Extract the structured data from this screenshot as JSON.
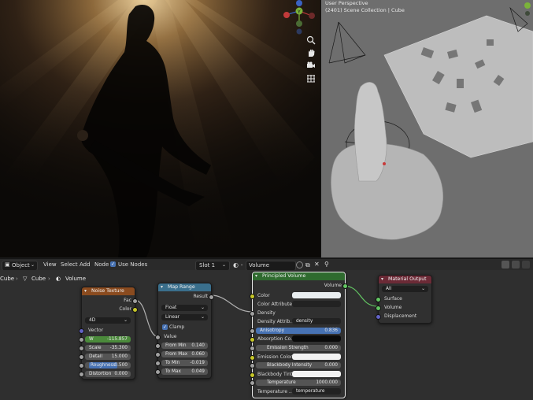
{
  "viewport": {
    "line1": "User Perspective",
    "line2": "(2401) Scene Collection | Cube"
  },
  "header": {
    "mode": "Object",
    "menus": [
      "View",
      "Select",
      "Add",
      "Node"
    ],
    "use_nodes": "Use Nodes",
    "slot": "Slot 1",
    "material": "Volume"
  },
  "breadcrumb": {
    "object": "Cube",
    "mesh": "Cube",
    "material": "Volume"
  },
  "nodes": {
    "noise": {
      "title": "Noise Texture",
      "out_fac": "Fac",
      "out_color": "Color",
      "dimensions": "4D",
      "in_vector": "Vector",
      "w_label": "W",
      "w_value": "-115.857",
      "scale_label": "Scale",
      "scale_value": "-35.300",
      "detail_label": "Detail",
      "detail_value": "15.000",
      "roughness_label": "Roughness",
      "roughness_value": "0.500",
      "distortion_label": "Distortion",
      "distortion_value": "0.000"
    },
    "maprange": {
      "title": "Map Range",
      "out_result": "Result",
      "type": "Float",
      "interp": "Linear",
      "clamp": "Clamp",
      "in_value": "Value",
      "from_min_label": "From Min",
      "from_min_value": "0.140",
      "from_max_label": "From Max",
      "from_max_value": "0.060",
      "to_min_label": "To Min",
      "to_min_value": "-0.019",
      "to_max_label": "To Max",
      "to_max_value": "0.049"
    },
    "volume": {
      "title": "Principled Volume",
      "out_volume": "Volume",
      "color": "Color",
      "color_attr": "Color Attribute",
      "density": "Density",
      "density_attr_label": "Density Attrib...",
      "density_attr_value": "density",
      "anisotropy_label": "Anisotropy",
      "anisotropy_value": "0.836",
      "absorption": "Absorption Co...",
      "emission_strength_label": "Emission Strength",
      "emission_strength_value": "0.000",
      "emission_color": "Emission Color",
      "blackbody_intensity_label": "Blackbody Intensity",
      "blackbody_intensity_value": "0.000",
      "blackbody_tint": "Blackbody Tint",
      "temperature_label": "Temperature",
      "temperature_value": "1000.000",
      "temperature_attr_label": "Temperature ...",
      "temperature_attr_value": "temperature"
    },
    "output": {
      "title": "Material Output",
      "target": "All",
      "surface": "Surface",
      "volume": "Volume",
      "displacement": "Displacement"
    }
  },
  "colors": {
    "texture_header": "#8a4b1f",
    "converter_header": "#3a6f8c",
    "shader_header": "#2f6b2f",
    "output_header": "#6b2a36",
    "socket_float": "#a1a1a1",
    "socket_color": "#c7c729",
    "socket_vector": "#6363c7",
    "socket_shader": "#63c763"
  }
}
